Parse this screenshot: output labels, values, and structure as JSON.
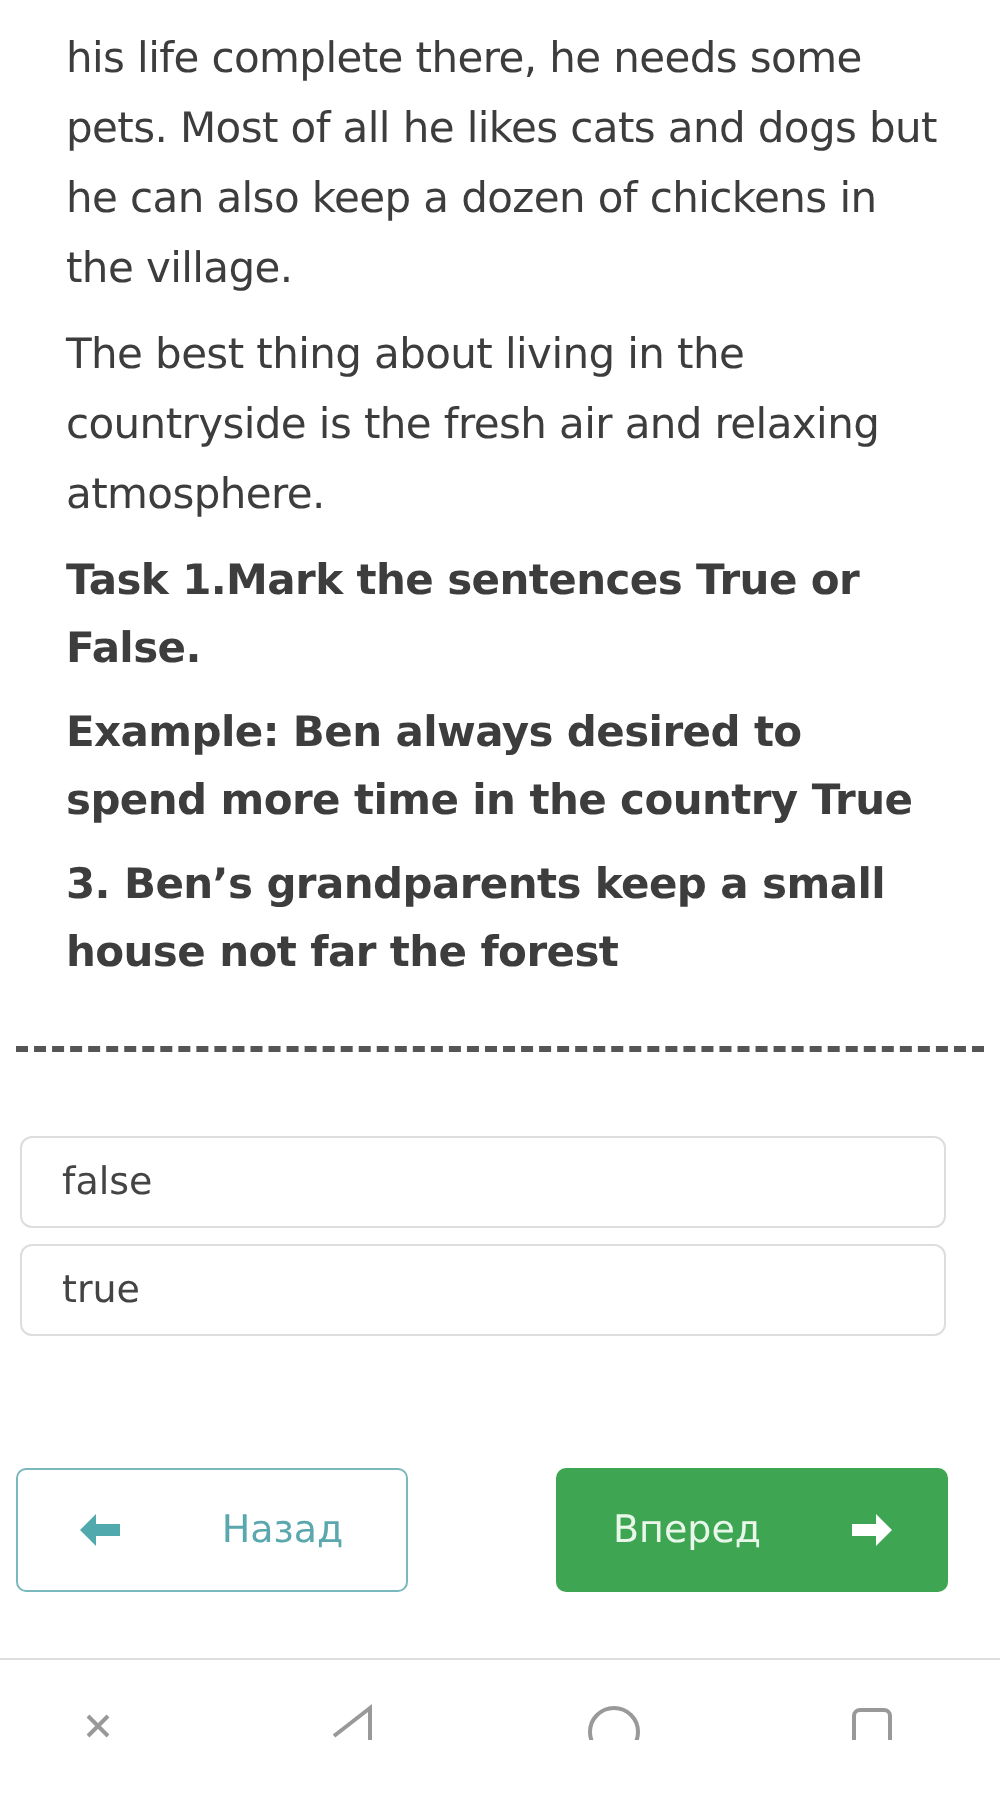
{
  "passage": [
    "his life complete there, he needs some pets. Most of all he likes cats and dogs but he can also keep a dozen of chickens in the village.",
    "The best thing about living in the countryside is the fresh air and relaxing atmosphere."
  ],
  "task": "Task 1.Mark the sentences True or False.",
  "example": "Example: Ben always desired to spend more time in the country True",
  "question": "3. Ben’s grandparents keep a small house not far the forest",
  "options": [
    {
      "label": "false"
    },
    {
      "label": "true"
    }
  ],
  "nav": {
    "back": "Назад",
    "next": "Вперед"
  }
}
